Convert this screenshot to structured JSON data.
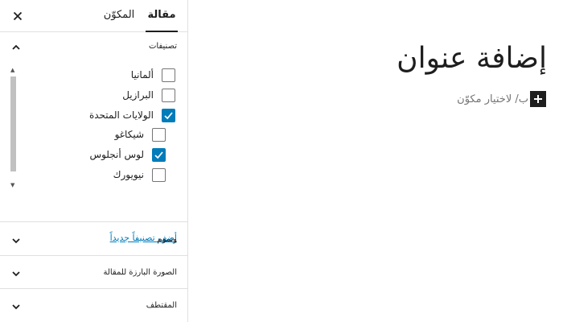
{
  "sidebar": {
    "tabs": [
      {
        "label": "مقالة"
      },
      {
        "label": "المكوّن"
      }
    ],
    "categories_panel": {
      "title": "تصنيفات",
      "items": [
        {
          "label": "ألمانيا",
          "checked": false,
          "level": 0
        },
        {
          "label": "البرازيل",
          "checked": false,
          "level": 0
        },
        {
          "label": "الولايات المتحدة",
          "checked": true,
          "level": 0
        },
        {
          "label": "شيكاغو",
          "checked": false,
          "level": 1
        },
        {
          "label": "لوس أنجلوس",
          "checked": true,
          "level": 1
        },
        {
          "label": "نيويورك",
          "checked": false,
          "level": 1
        }
      ],
      "add_link": "أضف تصنيفاً جديداً"
    },
    "tags_panel": {
      "title": "وسوم"
    },
    "featured_image_panel": {
      "title": "الصورة البارزة للمقالة"
    },
    "excerpt_panel": {
      "title": "المقتطف"
    }
  },
  "editor": {
    "title_placeholder": "إضافة عنوان",
    "block_prompt": "/ لاختيار مكوّن",
    "block_prompt_prefix": "ب"
  },
  "colors": {
    "accent": "#007cba",
    "text": "#1e1e1e",
    "muted": "#757575",
    "border": "#e0e0e0"
  }
}
